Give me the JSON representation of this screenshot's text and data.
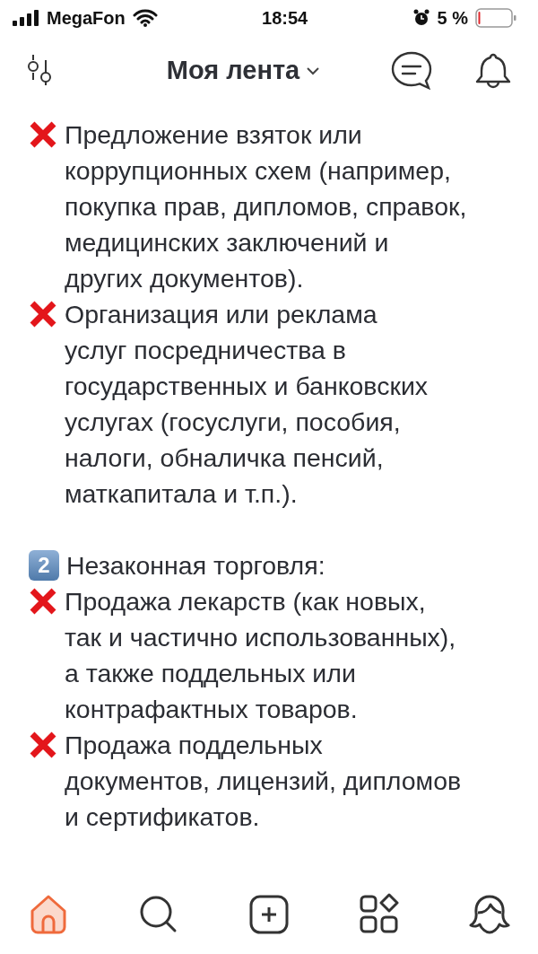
{
  "status_bar": {
    "carrier": "MegaFon",
    "time": "18:54",
    "battery": "5 %"
  },
  "header": {
    "title": "Моя лента"
  },
  "post": [
    {
      "kind": "cross",
      "text": "Предложение взяток или\nкоррупционных схем (например,\nпокупка прав, дипломов, справок,\nмедицинских заключений и\nдругих документов)."
    },
    {
      "kind": "cross",
      "text": "Организация или реклама\nуслуг посредничества в\nгосударственных и банковских\nуслугах (госуслуги, пособия,\nналоги, обналичка пенсий,\nматкапитала и т.п.)."
    },
    {
      "kind": "blank"
    },
    {
      "kind": "number",
      "number": "2",
      "text": "Незаконная торговля:"
    },
    {
      "kind": "cross",
      "text": "Продажа лекарств (как новых,\nтак и частично использованных),\nа также поддельных или\nконтрафактных товаров."
    },
    {
      "kind": "cross",
      "text": "Продажа поддельных\nдокументов, лицензий, дипломов\nи сертификатов."
    }
  ],
  "tab_bar": [
    {
      "kind": "home",
      "selected": true
    },
    {
      "kind": "search",
      "selected": false
    },
    {
      "kind": "add",
      "selected": false
    },
    {
      "kind": "apps",
      "selected": false
    },
    {
      "kind": "profile",
      "selected": false
    }
  ]
}
